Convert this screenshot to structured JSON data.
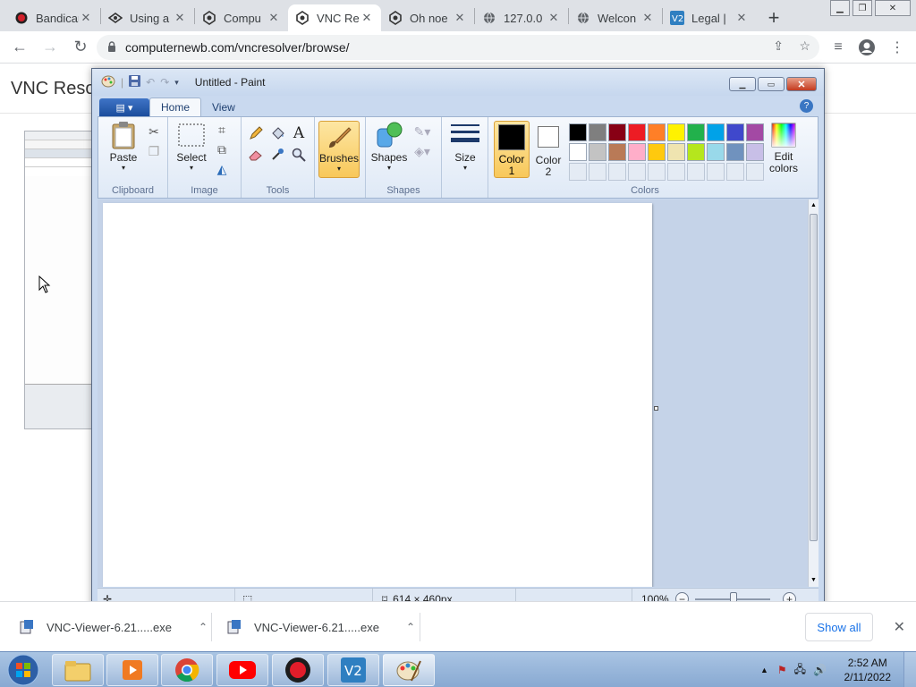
{
  "browser": {
    "tabs": [
      {
        "title": "Bandicam",
        "icon": "bandicam-icon",
        "active": false
      },
      {
        "title": "Using a",
        "icon": "drone-icon",
        "active": false
      },
      {
        "title": "Compu",
        "icon": "computernewb-icon",
        "active": false
      },
      {
        "title": "VNC Re",
        "icon": "computernewb-icon",
        "active": true
      },
      {
        "title": "Oh noe",
        "icon": "computernewb-icon",
        "active": false
      },
      {
        "title": "127.0.0",
        "icon": "globe-icon",
        "active": false
      },
      {
        "title": "Welcon",
        "icon": "globe-icon",
        "active": false
      },
      {
        "title": "Legal |",
        "icon": "vnc-icon",
        "active": false
      }
    ],
    "url": "computernewb.com/vncresolver/browse/"
  },
  "page": {
    "heading": "VNC Resol"
  },
  "paint": {
    "title": "Untitled - Paint",
    "tabs": {
      "home": "Home",
      "view": "View"
    },
    "clipboard": {
      "paste": "Paste",
      "label": "Clipboard"
    },
    "image": {
      "select": "Select",
      "label": "Image"
    },
    "tools": {
      "label": "Tools"
    },
    "brushes": "Brushes",
    "shapes": {
      "button": "Shapes",
      "label": "Shapes"
    },
    "size": "Size",
    "color1": [
      "Color",
      "1"
    ],
    "color2": [
      "Color",
      "2"
    ],
    "colors_label": "Colors",
    "edit_colors": [
      "Edit",
      "colors"
    ],
    "palette_row1": [
      "#000000",
      "#7f7f7f",
      "#880015",
      "#ed1c24",
      "#ff7f27",
      "#fff200",
      "#22b14c",
      "#00a2e8",
      "#3f48cc",
      "#a349a4"
    ],
    "palette_row2": [
      "#ffffff",
      "#c3c3c3",
      "#b97a57",
      "#ffaec9",
      "#ffc90e",
      "#efe4b0",
      "#b5e61d",
      "#99d9ea",
      "#7092be",
      "#c8bfe7"
    ],
    "color1_value": "#000000",
    "color2_value": "#ffffff",
    "canvas_size": "614 × 460px",
    "zoom": "100%"
  },
  "downloads": {
    "items": [
      {
        "name": "VNC-Viewer-6.21.....exe"
      },
      {
        "name": "VNC-Viewer-6.21.....exe"
      }
    ],
    "show_all": "Show all"
  },
  "taskbar": {
    "time": "2:52 AM",
    "date": "2/11/2022"
  }
}
